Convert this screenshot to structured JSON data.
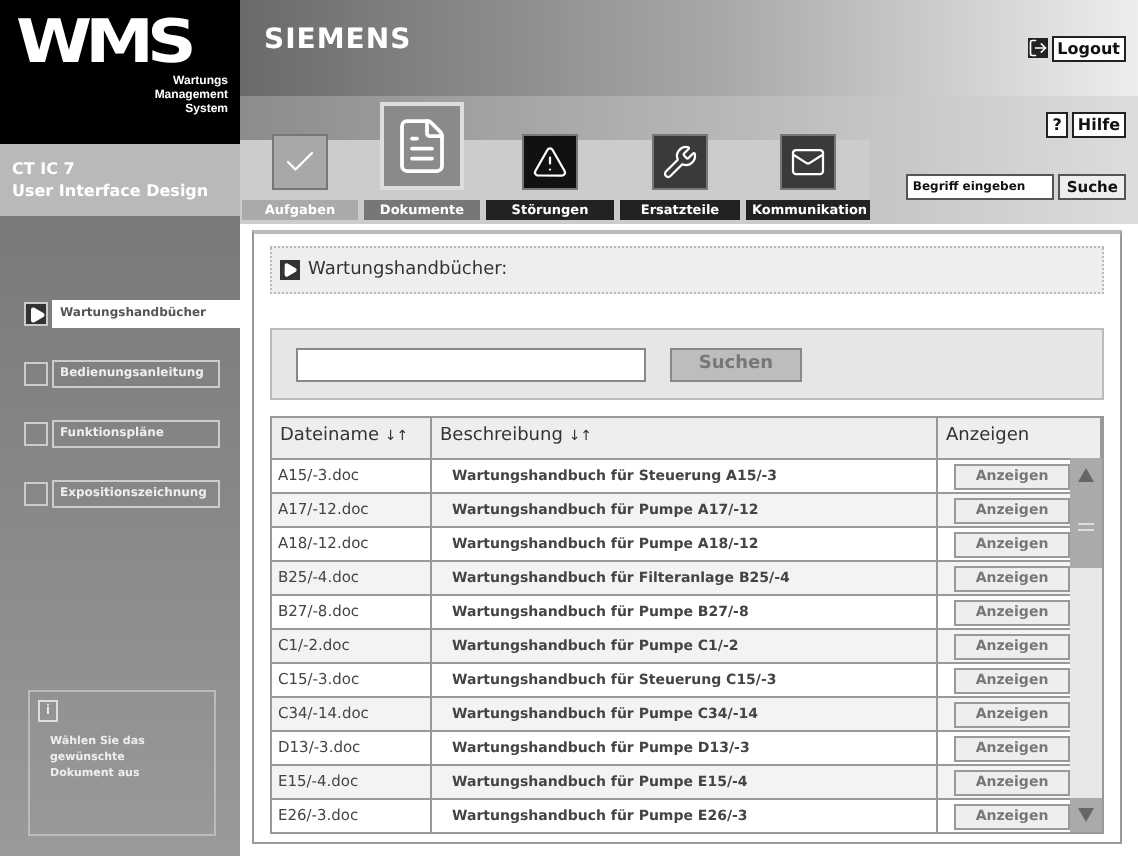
{
  "logo": {
    "text": "WMS",
    "subtitle": "Wartungs Management System"
  },
  "project": {
    "line1": "CT IC 7",
    "line2": "User Interface Design"
  },
  "brand": "SIEMENS",
  "logout": "Logout",
  "help": {
    "icon": "?",
    "label": "Hilfe"
  },
  "tabs": [
    {
      "label": "Aufgaben",
      "kind": "check",
      "selected": false
    },
    {
      "label": "Dokumente",
      "kind": "document",
      "selected": true
    },
    {
      "label": "Störungen",
      "kind": "warning",
      "selected": false
    },
    {
      "label": "Ersatzteile",
      "kind": "wrench",
      "selected": false
    },
    {
      "label": "Kommunikation",
      "kind": "mail",
      "selected": false
    }
  ],
  "quick_search": {
    "placeholder": "Begriff eingeben",
    "button": "Suche"
  },
  "nav": [
    {
      "label": "Wartungshandbücher",
      "selected": true
    },
    {
      "label": "Bedienungsanleitung",
      "selected": false
    },
    {
      "label": "Funktionspläne",
      "selected": false
    },
    {
      "label": "Expositionszeichnung",
      "selected": false
    }
  ],
  "hint": {
    "icon": "i",
    "text": "Wählen Sie das gewünschte Dokument aus"
  },
  "section_title": "Wartungshandbücher:",
  "search": {
    "button": "Suchen"
  },
  "table": {
    "columns": [
      {
        "label": "Dateiname",
        "sort": "↓↑"
      },
      {
        "label": "Beschreibung",
        "sort": "↓↑"
      },
      {
        "label": "Anzeigen"
      }
    ],
    "rows": [
      {
        "file": "A15/-3.doc",
        "description": "Wartungshandbuch für Steuerung A15/-3",
        "action": "Anzeigen"
      },
      {
        "file": "A17/-12.doc",
        "description": "Wartungshandbuch für Pumpe A17/-12",
        "action": "Anzeigen"
      },
      {
        "file": "A18/-12.doc",
        "description": "Wartungshandbuch für Pumpe A18/-12",
        "action": "Anzeigen"
      },
      {
        "file": "B25/-4.doc",
        "description": "Wartungshandbuch für Filteranlage B25/-4",
        "action": "Anzeigen"
      },
      {
        "file": "B27/-8.doc",
        "description": "Wartungshandbuch für Pumpe B27/-8",
        "action": "Anzeigen"
      },
      {
        "file": "C1/-2.doc",
        "description": "Wartungshandbuch für Pumpe C1/-2",
        "action": "Anzeigen"
      },
      {
        "file": "C15/-3.doc",
        "description": "Wartungshandbuch für Steuerung C15/-3",
        "action": "Anzeigen"
      },
      {
        "file": "C34/-14.doc",
        "description": "Wartungshandbuch für Pumpe C34/-14",
        "action": "Anzeigen"
      },
      {
        "file": "D13/-3.doc",
        "description": "Wartungshandbuch für Pumpe D13/-3",
        "action": "Anzeigen"
      },
      {
        "file": "E15/-4.doc",
        "description": "Wartungshandbuch für Pumpe E15/-4",
        "action": "Anzeigen"
      },
      {
        "file": "E26/-3.doc",
        "description": "Wartungshandbuch für Pumpe E26/-3",
        "action": "Anzeigen"
      }
    ]
  }
}
